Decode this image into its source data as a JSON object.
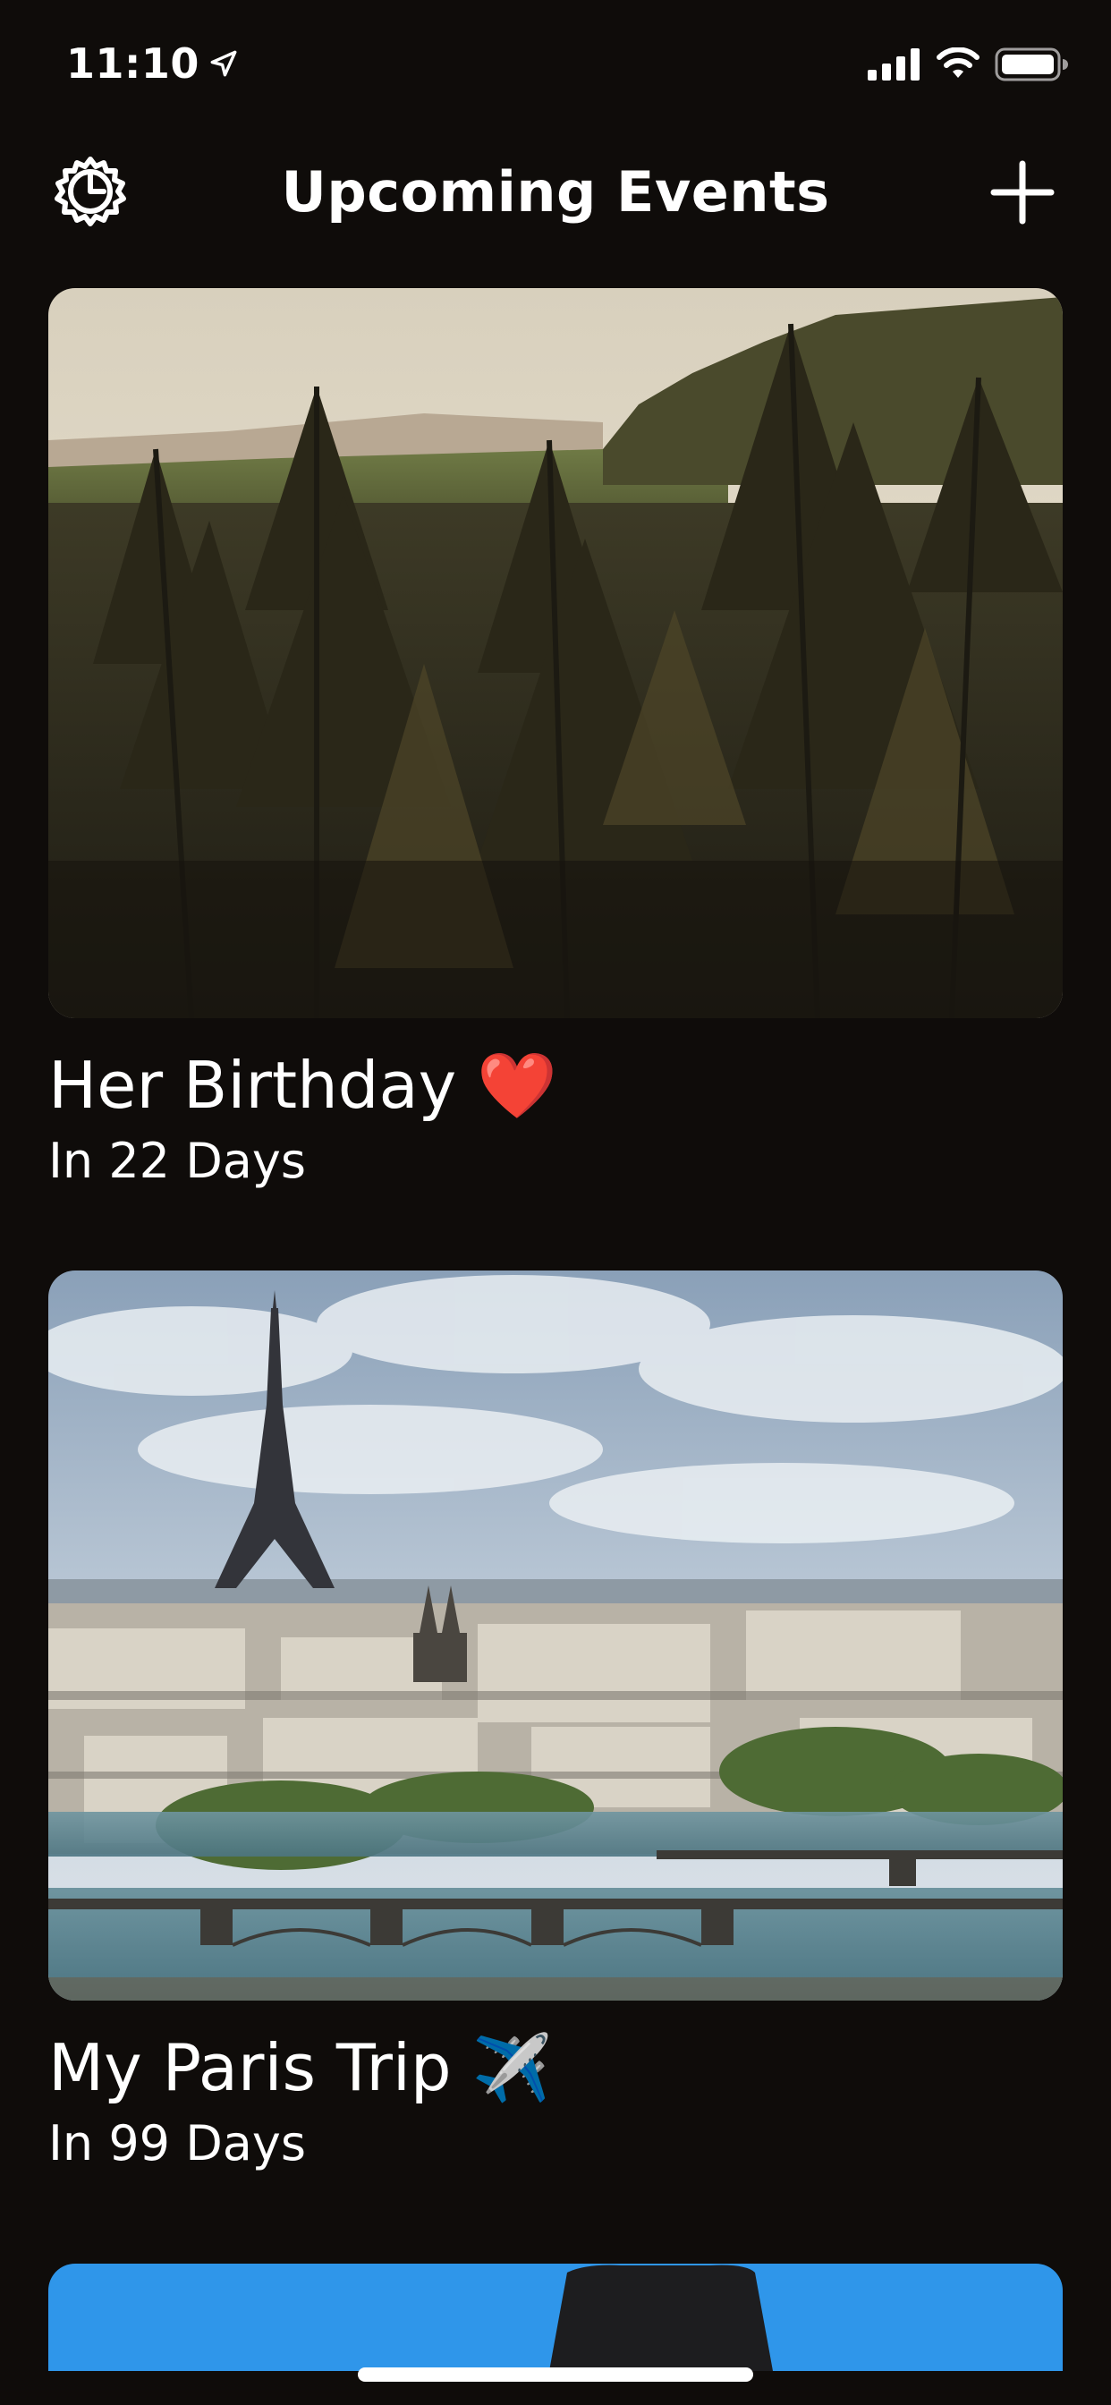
{
  "status_bar": {
    "time": "11:10",
    "location_icon": "location-arrow-icon",
    "signal_icon": "cellular-signal-icon",
    "wifi_icon": "wifi-icon",
    "battery_icon": "battery-icon"
  },
  "nav": {
    "title": "Upcoming Events",
    "settings_icon": "gear-icon",
    "add_icon": "plus-icon"
  },
  "events": [
    {
      "title": "Her Birthday ❤️",
      "countdown": "In 22 Days",
      "image": "forest-landscape-photo"
    },
    {
      "title": "My Paris Trip ✈️",
      "countdown": "In 99 Days",
      "image": "paris-eiffel-tower-photo"
    }
  ],
  "colors": {
    "background": "#0f0c0a",
    "text": "#ffffff",
    "partial_card": "#2f96ea"
  }
}
